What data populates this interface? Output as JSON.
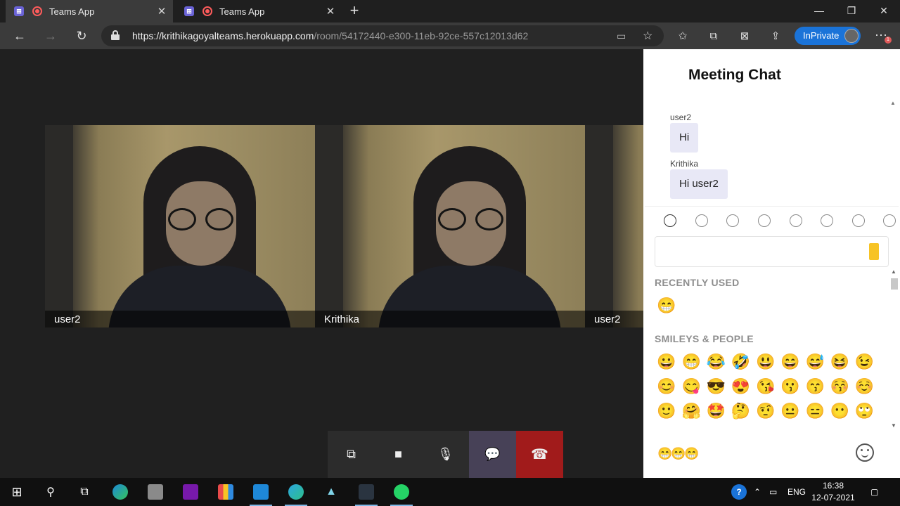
{
  "browser": {
    "tabs": [
      {
        "title": "Teams App",
        "active": true
      },
      {
        "title": "Teams App",
        "active": false
      }
    ],
    "url_host": "https://krithikagoyalteams.herokuapp.com",
    "url_path": "/room/54172440-e300-11eb-92ce-557c12013d62",
    "inprivate_label": "InPrivate",
    "notification_count": "1"
  },
  "meeting": {
    "participants": [
      {
        "name": "user2"
      },
      {
        "name": "Krithika"
      },
      {
        "name": "user2"
      }
    ]
  },
  "chat": {
    "title": "Meeting Chat",
    "messages": [
      {
        "sender": "user2",
        "text": "Hi"
      },
      {
        "sender": "Krithika",
        "text": "Hi user2"
      }
    ],
    "picker": {
      "categories": [
        "people",
        "nature",
        "food",
        "activity",
        "travel",
        "objects",
        "symbols",
        "flags"
      ],
      "recent_label": "RECENTLY USED",
      "recent": [
        "😁"
      ],
      "smileys_label": "SMILEYS & PEOPLE",
      "smileys": [
        "😀",
        "😁",
        "😂",
        "🤣",
        "😃",
        "😄",
        "😅",
        "😆",
        "😉",
        "😊",
        "😋",
        "😎",
        "😍",
        "😘",
        "😗",
        "😙",
        "😚",
        "☺️",
        "🙂",
        "🤗",
        "🤩",
        "🤔",
        "🤨",
        "😐",
        "😑",
        "😶",
        "🙄"
      ]
    },
    "draft": "😁😁😁"
  },
  "taskbar": {
    "language": "ENG",
    "time": "16:38",
    "date": "12-07-2021"
  },
  "colors": {
    "accent": "#1a73d8",
    "end_call": "#a11b1b",
    "chat_active": "#474157",
    "bubble": "#e8e8f6"
  }
}
